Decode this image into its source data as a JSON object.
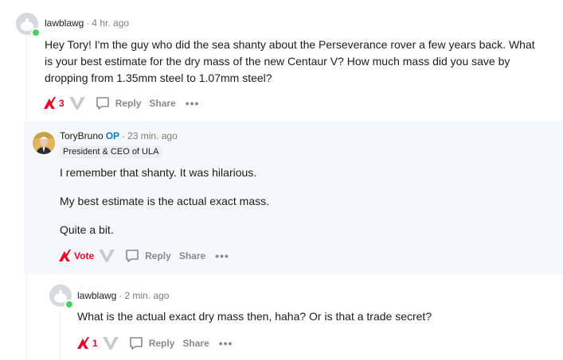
{
  "comments": [
    {
      "username": "lawblawg",
      "time": "4 hr. ago",
      "body": [
        "Hey Tory! I'm the guy who did the sea shanty about the Perseverance rover a few years back. What is your best estimate for the dry mass of the new Centaur V? How much mass did you save by dropping from 1.35mm steel to 1.07mm steel?"
      ],
      "vote_count": "3",
      "reply_label": "Reply",
      "share_label": "Share",
      "more_label": "•••"
    },
    {
      "username": "ToryBruno",
      "op_label": "OP",
      "time": "23 min. ago",
      "flair": "President & CEO of ULA",
      "body": [
        "I remember that shanty. It was hilarious.",
        "My best estimate is the actual exact mass.",
        "Quite a bit."
      ],
      "vote_count": "Vote",
      "reply_label": "Reply",
      "share_label": "Share",
      "more_label": "•••"
    },
    {
      "username": "lawblawg",
      "time": "2 min. ago",
      "body": [
        "What is the actual exact dry mass then, haha? Or is that a trade secret?"
      ],
      "vote_count": "1",
      "reply_label": "Reply",
      "share_label": "Share",
      "more_label": "•••"
    }
  ],
  "separator": "·",
  "colors": {
    "upvote": "#ea0027",
    "op": "#0079d3",
    "online": "#46d160",
    "muted": "#878a8c"
  }
}
